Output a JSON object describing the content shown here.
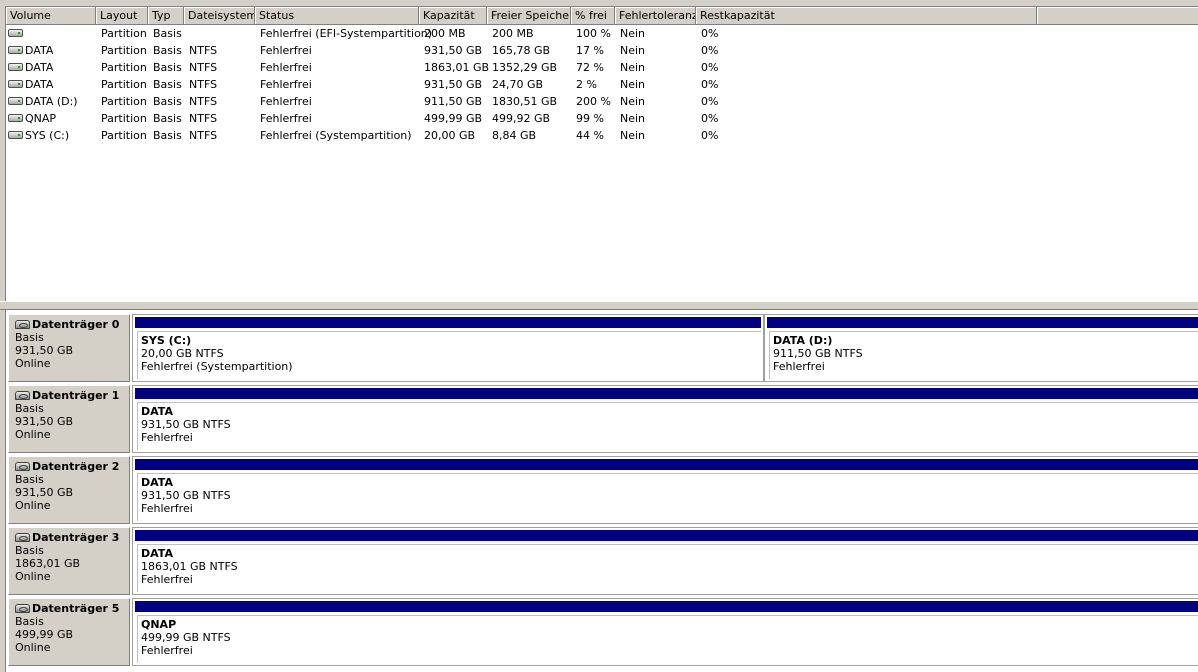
{
  "columns": [
    "Volume",
    "Layout",
    "Typ",
    "Dateisystem",
    "Status",
    "Kapazität",
    "Freier Speicher",
    "% frei",
    "Fehlertoleranz",
    "Restkapazität"
  ],
  "volumes": [
    {
      "volume": "",
      "layout": "Partition",
      "type": "Basis",
      "fs": "",
      "status": "Fehlerfrei (EFI-Systempartition)",
      "capacity": "200 MB",
      "free": "200 MB",
      "pct": "100 %",
      "fault": "Nein",
      "rest": "0%"
    },
    {
      "volume": "DATA",
      "layout": "Partition",
      "type": "Basis",
      "fs": "NTFS",
      "status": "Fehlerfrei",
      "capacity": "931,50 GB",
      "free": "165,78 GB",
      "pct": "17 %",
      "fault": "Nein",
      "rest": "0%"
    },
    {
      "volume": "DATA",
      "layout": "Partition",
      "type": "Basis",
      "fs": "NTFS",
      "status": "Fehlerfrei",
      "capacity": "1863,01 GB",
      "free": "1352,29 GB",
      "pct": "72 %",
      "fault": "Nein",
      "rest": "0%"
    },
    {
      "volume": "DATA",
      "layout": "Partition",
      "type": "Basis",
      "fs": "NTFS",
      "status": "Fehlerfrei",
      "capacity": "931,50 GB",
      "free": "24,70 GB",
      "pct": "2 %",
      "fault": "Nein",
      "rest": "0%"
    },
    {
      "volume": "DATA (D:)",
      "layout": "Partition",
      "type": "Basis",
      "fs": "NTFS",
      "status": "Fehlerfrei",
      "capacity": "911,50 GB",
      "free": "1830,51 GB",
      "pct": "200 %",
      "fault": "Nein",
      "rest": "0%"
    },
    {
      "volume": "QNAP",
      "layout": "Partition",
      "type": "Basis",
      "fs": "NTFS",
      "status": "Fehlerfrei",
      "capacity": "499,99 GB",
      "free": "499,92 GB",
      "pct": "99 %",
      "fault": "Nein",
      "rest": "0%"
    },
    {
      "volume": "SYS (C:)",
      "layout": "Partition",
      "type": "Basis",
      "fs": "NTFS",
      "status": "Fehlerfrei (Systempartition)",
      "capacity": "20,00 GB",
      "free": "8,84 GB",
      "pct": "44 %",
      "fault": "Nein",
      "rest": "0%"
    }
  ],
  "disks": [
    {
      "name": "Datenträger 0",
      "type": "Basis",
      "size": "931,50 GB",
      "state": "Online",
      "partitions": [
        {
          "name": "SYS  (C:)",
          "size": "20,00 GB NTFS",
          "status": "Fehlerfrei (Systempartition)"
        },
        {
          "name": "DATA  (D:)",
          "size": "911,50 GB NTFS",
          "status": "Fehlerfrei"
        }
      ]
    },
    {
      "name": "Datenträger 1",
      "type": "Basis",
      "size": "931,50 GB",
      "state": "Online",
      "partitions": [
        {
          "name": "DATA",
          "size": "931,50 GB NTFS",
          "status": "Fehlerfrei"
        }
      ]
    },
    {
      "name": "Datenträger 2",
      "type": "Basis",
      "size": "931,50 GB",
      "state": "Online",
      "partitions": [
        {
          "name": "DATA",
          "size": "931,50 GB NTFS",
          "status": "Fehlerfrei"
        }
      ]
    },
    {
      "name": "Datenträger 3",
      "type": "Basis",
      "size": "1863,01 GB",
      "state": "Online",
      "partitions": [
        {
          "name": "DATA",
          "size": "1863,01 GB NTFS",
          "status": "Fehlerfrei"
        }
      ]
    },
    {
      "name": "Datenträger 5",
      "type": "Basis",
      "size": "499,99 GB",
      "state": "Online",
      "partitions": [
        {
          "name": "QNAP",
          "size": "499,99 GB NTFS",
          "status": "Fehlerfrei"
        }
      ]
    }
  ],
  "colors": {
    "partition_bar": "#000080",
    "chrome": "#d4d0c8"
  }
}
